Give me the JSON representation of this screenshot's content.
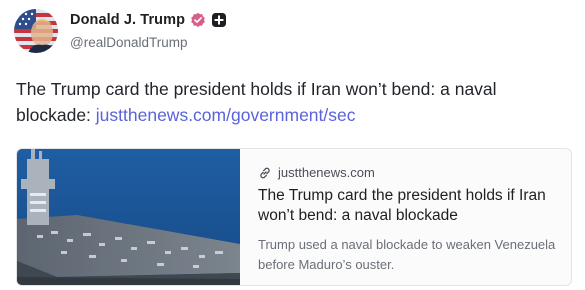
{
  "author": {
    "display_name": "Donald J. Trump",
    "handle": "@realDonaldTrump",
    "avatar_icon": "avatar-flag-portrait",
    "verified_icon": "verified-badge-icon",
    "extra_icon": "plus-square-icon",
    "verified_color": "#d65e8b"
  },
  "post": {
    "text": "The Trump card the president holds if Iran won’t bend: a naval blockade: ",
    "link_text": "justthenews.com/government/sec",
    "link_color": "#5a63d8"
  },
  "link_card": {
    "domain": "justthenews.com",
    "domain_icon": "link-icon",
    "title": "The Trump card the president holds if Iran won’t bend: a naval blockade",
    "description": "Trump used a naval blockade to weaken Venezuela before Maduro’s ouster.",
    "image_icon": "aircraft-carrier-photo"
  }
}
